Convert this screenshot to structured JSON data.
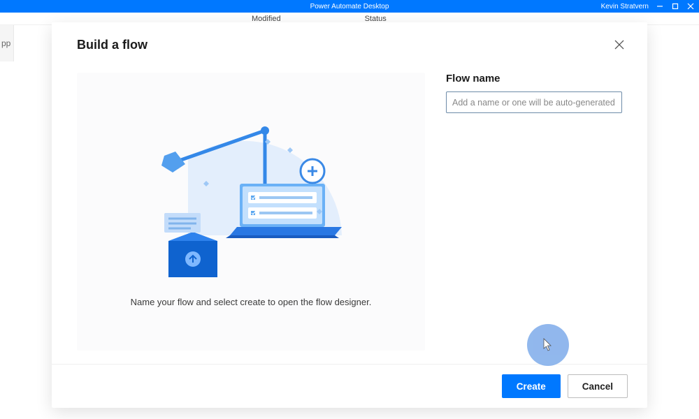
{
  "titlebar": {
    "app_title": "Power Automate Desktop",
    "user_name": "Kevin Stratvern"
  },
  "background": {
    "col_modified": "Modified",
    "col_status": "Status",
    "sidebar_text": "pp"
  },
  "modal": {
    "title": "Build a flow",
    "illustration_caption": "Name your flow and select create to open the flow designer.",
    "flow_name_label": "Flow name",
    "flow_name_placeholder": "Add a name or one will be auto-generated",
    "flow_name_value": "",
    "create_label": "Create",
    "cancel_label": "Cancel"
  }
}
